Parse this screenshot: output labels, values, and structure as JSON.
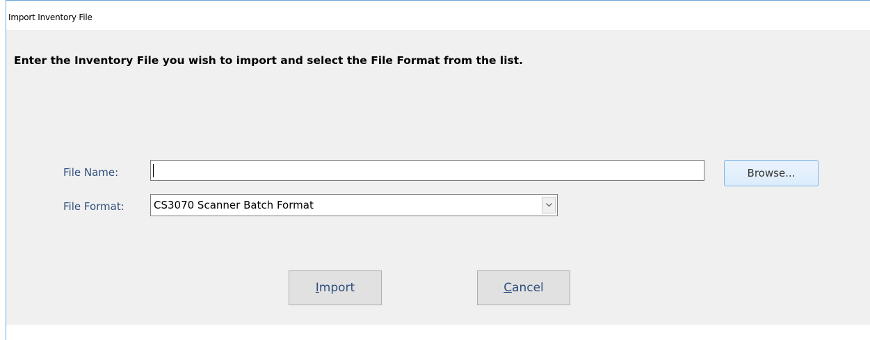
{
  "window": {
    "title": "Import Inventory File"
  },
  "instruction": "Enter the Inventory File you wish to import and select the File Format from the list.",
  "file_name": {
    "label": "File Name:",
    "value": ""
  },
  "file_format": {
    "label": "File Format:",
    "selected": "CS3070 Scanner Batch Format"
  },
  "buttons": {
    "browse": "Browse...",
    "import_first": "I",
    "import_rest": "mport",
    "cancel_first": "C",
    "cancel_rest": "ancel"
  },
  "colors": {
    "label_text": "#2f4e7d",
    "dialog_background": "#f0f0f0",
    "window_border": "#6aa6dd",
    "browse_border": "#7eb4ea"
  },
  "icons": {
    "dropdown": "chevron-down-icon"
  }
}
